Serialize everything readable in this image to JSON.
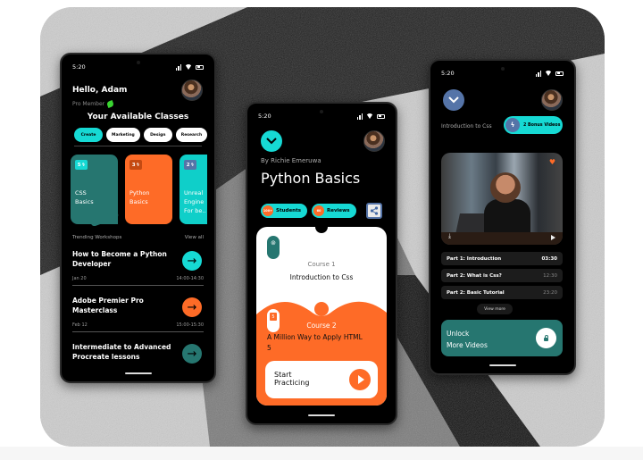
{
  "colors": {
    "teal": "#267670",
    "cyan": "#16d9d4",
    "orange": "#fe6b27",
    "blue": "#5574a8",
    "screen_bg": "#000000"
  },
  "status_bar": {
    "time": "5:20"
  },
  "phone_home": {
    "greeting": "Hello, Adam",
    "membership": "Pro Member",
    "section_title": "Your Available Classes",
    "filters": [
      {
        "label": "Create",
        "active": true
      },
      {
        "label": "Marketing",
        "active": false
      },
      {
        "label": "Design",
        "active": false
      },
      {
        "label": "Research",
        "active": false
      }
    ],
    "classes": [
      {
        "count": "5",
        "title_line1": "CSS",
        "title_line2": "Basics"
      },
      {
        "count": "3",
        "title_line1": "Python",
        "title_line2": "Basics"
      },
      {
        "count": "2",
        "title_line1": "Unreal",
        "title_line2": "Engine",
        "title_line3": "For be.."
      }
    ],
    "trending_label": "Trending Workshops",
    "view_all": "View all",
    "workshops": [
      {
        "title": "How to Become a Python Developer",
        "date": "Jan 20",
        "time": "14:00-14:30",
        "arrow_color": "#16d9d4"
      },
      {
        "title": "Adobe Premier Pro Masterclass",
        "date": "Feb 12",
        "time": "15:00-15:30",
        "arrow_color": "#fe6b27"
      },
      {
        "title": "Intermediate to Advanced Procreate lessons",
        "arrow_color": "#267670"
      }
    ]
  },
  "phone_course": {
    "author": "By Richie Emeruwa",
    "title": "Python Basics",
    "students_count": "100+",
    "students_label": "Students",
    "reviews_count": "60",
    "reviews_label": "Reviews",
    "course1_label": "Course 1",
    "course1_title": "Introduction to Css",
    "course2_label": "Course 2",
    "course2_title": "A Million Way to Apply HTML 5",
    "course2_icon_text": "5",
    "start_label": "Start Practicing"
  },
  "phone_video": {
    "lesson_title": "Introduction to Css",
    "bonus_label": "2 Bonus Videos",
    "parts": [
      {
        "title": "Part 1: Introduction",
        "duration": "03:30",
        "active": true
      },
      {
        "title": "Part 2: What is Css?",
        "duration": "12:30",
        "active": false
      },
      {
        "title": "Part 2: Basic Tutorial",
        "duration": "23:20",
        "active": false
      }
    ],
    "view_more": "View more",
    "unlock_line1": "Unlock",
    "unlock_line2": "More Videos"
  }
}
